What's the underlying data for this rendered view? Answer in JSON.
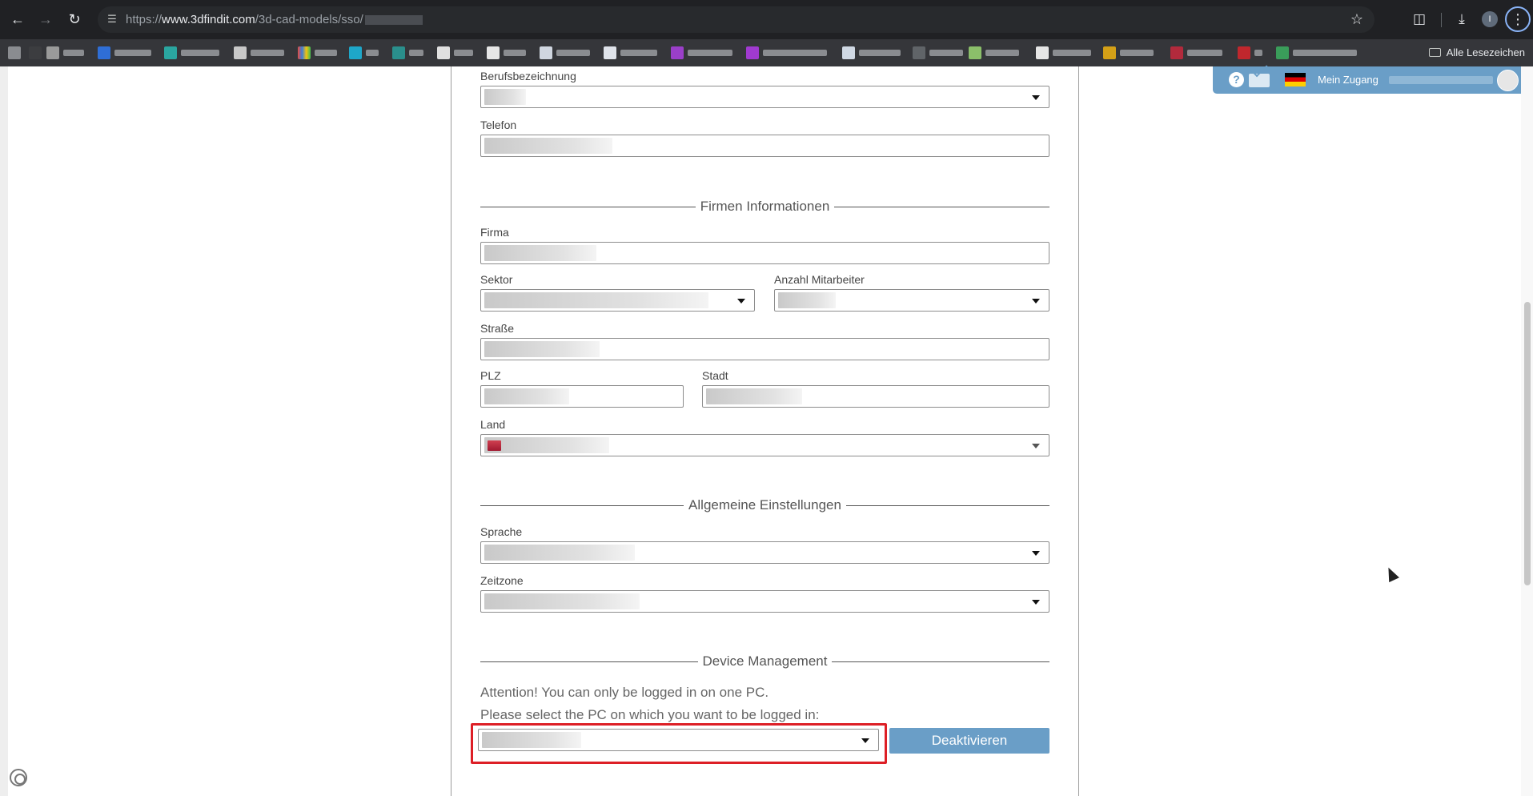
{
  "browser": {
    "url_prefix": "https://",
    "url_host": "www.3dfindit.com",
    "url_path": "/3d-cad-models/sso/",
    "all_bookmarks_label": "Alle Lesezeichen",
    "profile_initial": "I"
  },
  "account": {
    "help_symbol": "?",
    "label": "Mein Zugang"
  },
  "fields": {
    "job_title_label": "Berufsbezeichnung",
    "phone_label": "Telefon",
    "company_label": "Firma",
    "sector_label": "Sektor",
    "employees_label": "Anzahl Mitarbeiter",
    "street_label": "Straße",
    "zip_label": "PLZ",
    "city_label": "Stadt",
    "country_label": "Land",
    "language_label": "Sprache",
    "timezone_label": "Zeitzone"
  },
  "sections": {
    "company": "Firmen Informationen",
    "general": "Allgemeine Einstellungen",
    "device": "Device Management"
  },
  "device": {
    "attention": "Attention! You can only be logged in on one PC.",
    "instruction": "Please select the PC on which you want to be logged in:",
    "deactivate_label": "Deaktivieren"
  }
}
